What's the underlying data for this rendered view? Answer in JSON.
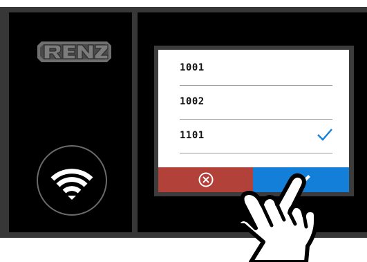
{
  "device": {
    "logo_text": "RENZ",
    "wifi_icon": "wifi-icon"
  },
  "list": {
    "items": [
      {
        "label": "1001",
        "selected": false
      },
      {
        "label": "1002",
        "selected": false
      },
      {
        "label": "1101",
        "selected": true
      }
    ]
  },
  "buttons": {
    "cancel_icon": "cancel-circle-x-icon",
    "ok_icon": "pencil-icon"
  },
  "colors": {
    "cancel": "#b2413a",
    "confirm": "#137fd8",
    "check": "#137fd8"
  }
}
